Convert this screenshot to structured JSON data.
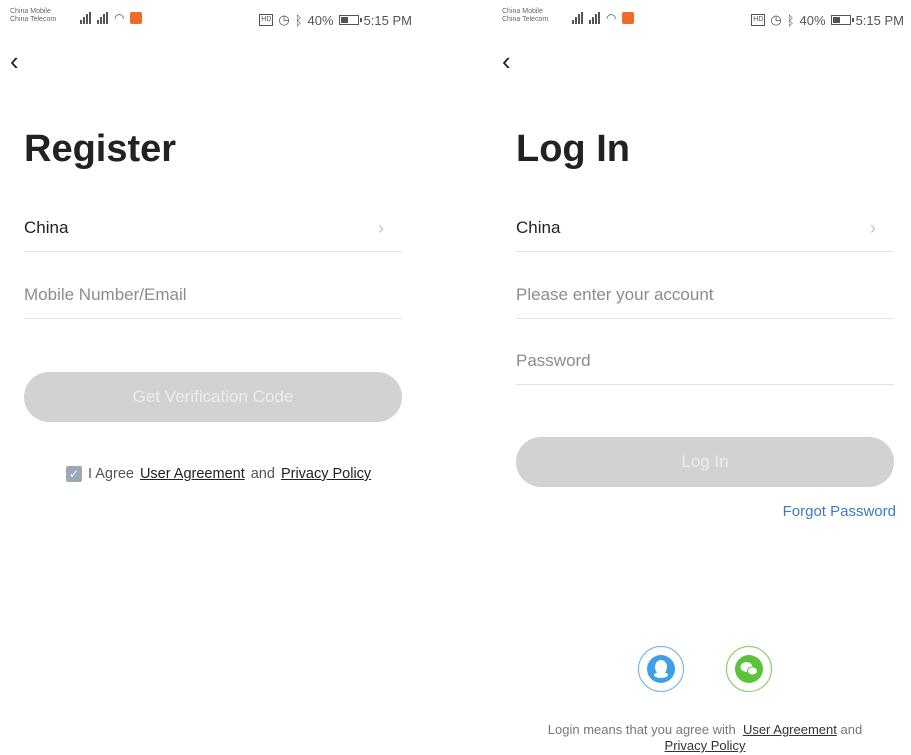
{
  "status_bar": {
    "carrier_1": "China Mobile",
    "carrier_2": "China Telecom",
    "battery": "40%",
    "time": "5:15 PM"
  },
  "register": {
    "title": "Register",
    "region_value": "China",
    "account_placeholder": "Mobile Number/Email",
    "submit_label": "Get Verification Code",
    "agree_prefix": "I Agree",
    "user_agreement": "User Agreement",
    "and": "and",
    "privacy_policy": "Privacy Policy"
  },
  "login": {
    "title": "Log In",
    "region_value": "China",
    "account_placeholder": "Please enter your account",
    "password_placeholder": "Password",
    "submit_label": "Log In",
    "forgot_label": "Forgot Password",
    "footer_prefix": "Login means that you agree with",
    "user_agreement": "User Agreement",
    "and": "and",
    "privacy_policy": "Privacy Policy"
  },
  "colors": {
    "button_disabled": "#d2d2d2",
    "link_blue": "#3f79c3",
    "qq_blue": "#3fa0e8",
    "wechat_green": "#5cc23b"
  },
  "icons": {
    "back": "chevron-left-icon",
    "region": "chevron-right-icon",
    "checkbox": "checkbox-checked-icon",
    "qq": "qq-icon",
    "wechat": "wechat-icon"
  }
}
